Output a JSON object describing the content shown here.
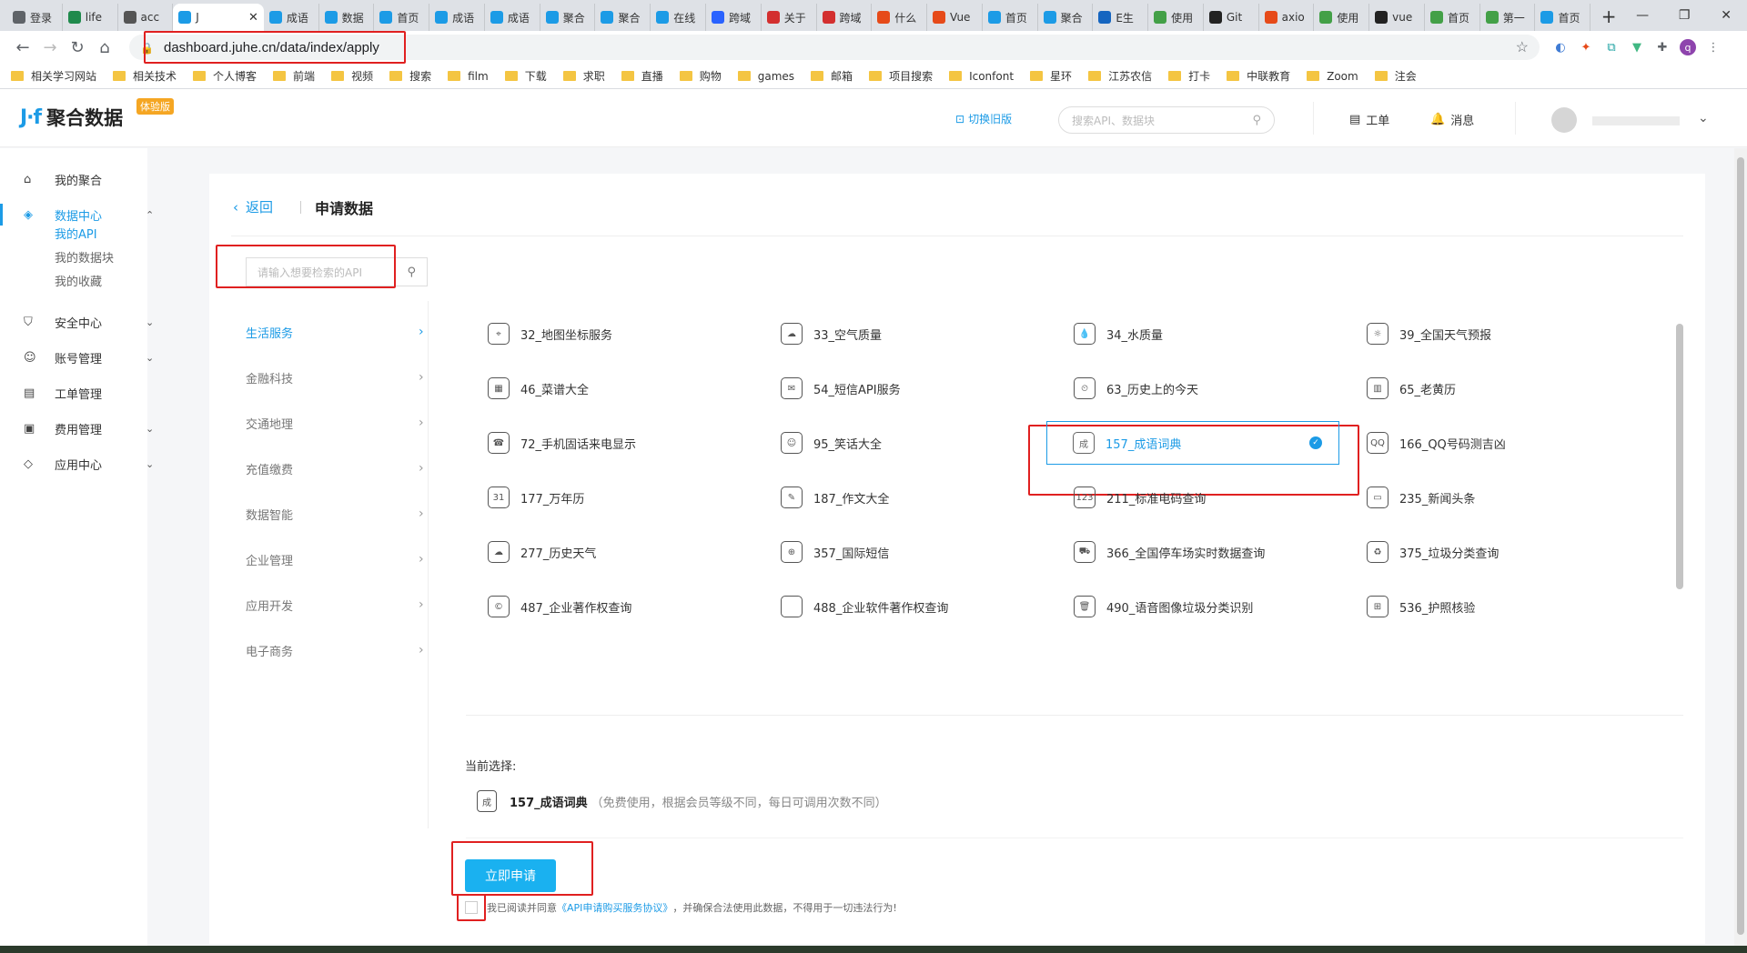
{
  "browser": {
    "tabs": [
      {
        "label": "登录",
        "color": "#5f6368"
      },
      {
        "label": "life",
        "color": "#1f8a4c"
      },
      {
        "label": "acc",
        "color": "#555555"
      },
      {
        "label": "J",
        "color": "#1c9be6",
        "active": true
      },
      {
        "label": "成语",
        "color": "#1c9be6"
      },
      {
        "label": "数据",
        "color": "#1c9be6"
      },
      {
        "label": "首页",
        "color": "#1c9be6"
      },
      {
        "label": "成语",
        "color": "#1c9be6"
      },
      {
        "label": "成语",
        "color": "#1c9be6"
      },
      {
        "label": "聚合",
        "color": "#1c9be6"
      },
      {
        "label": "聚合",
        "color": "#1c9be6"
      },
      {
        "label": "在线",
        "color": "#1c9be6"
      },
      {
        "label": "跨域",
        "color": "#2962ff"
      },
      {
        "label": "关于",
        "color": "#d32f2f"
      },
      {
        "label": "跨域",
        "color": "#d32f2f"
      },
      {
        "label": "什么",
        "color": "#e64a19"
      },
      {
        "label": "Vue",
        "color": "#e64a19"
      },
      {
        "label": "首页",
        "color": "#1c9be6"
      },
      {
        "label": "聚合",
        "color": "#1c9be6"
      },
      {
        "label": "E生",
        "color": "#1565c0"
      },
      {
        "label": "使用",
        "color": "#43a047"
      },
      {
        "label": "Git",
        "color": "#222222"
      },
      {
        "label": "axio",
        "color": "#e64a19"
      },
      {
        "label": "使用",
        "color": "#43a047"
      },
      {
        "label": "vue",
        "color": "#222222"
      },
      {
        "label": "首页",
        "color": "#43a047"
      },
      {
        "label": "第一",
        "color": "#43a047"
      },
      {
        "label": "首页",
        "color": "#1c9be6"
      }
    ],
    "url": "dashboard.juhe.cn/data/index/apply",
    "bookmarks": [
      "相关学习网站",
      "相关技术",
      "个人博客",
      "前端",
      "视频",
      "搜索",
      "film",
      "下载",
      "求职",
      "直播",
      "购物",
      "games",
      "邮箱",
      "项目搜索",
      "Iconfont",
      "星环",
      "江苏农信",
      "打卡",
      "中联教育",
      "Zoom",
      "注会"
    ]
  },
  "header": {
    "logo_text": "聚合数据",
    "logo_badge": "体验版",
    "old_version": "切换旧版",
    "search_placeholder": "搜索API、数据块",
    "ticket": "工单",
    "messages": "消息"
  },
  "sidebar": {
    "items": [
      {
        "label": "我的聚合",
        "icon": "home-icon"
      },
      {
        "label": "数据中心",
        "icon": "layers-icon",
        "active": true,
        "expanded": true
      },
      {
        "label": "安全中心",
        "icon": "shield-icon"
      },
      {
        "label": "账号管理",
        "icon": "user-icon"
      },
      {
        "label": "工单管理",
        "icon": "ticket-icon"
      },
      {
        "label": "费用管理",
        "icon": "wallet-icon"
      },
      {
        "label": "应用中心",
        "icon": "apps-icon"
      }
    ],
    "sub_items": [
      {
        "label": "我的API",
        "active": true
      },
      {
        "label": "我的数据块"
      },
      {
        "label": "我的收藏"
      }
    ]
  },
  "main": {
    "back": "返回",
    "title": "申请数据",
    "api_search_placeholder": "请输入想要检索的API",
    "categories": [
      "生活服务",
      "金融科技",
      "交通地理",
      "充值缴费",
      "数据智能",
      "企业管理",
      "应用开发",
      "电子商务"
    ],
    "apis": [
      "32_地图坐标服务",
      "33_空气质量",
      "34_水质量",
      "39_全国天气预报",
      "46_菜谱大全",
      "54_短信API服务",
      "63_历史上的今天",
      "65_老黄历",
      "72_手机固话来电显示",
      "95_笑话大全",
      "157_成语词典",
      "166_QQ号码测吉凶",
      "177_万年历",
      "187_作文大全",
      "211_标准电码查询",
      "235_新闻头条",
      "277_历史天气",
      "357_国际短信",
      "366_全国停车场实时数据查询",
      "375_垃圾分类查询",
      "487_企业著作权查询",
      "488_企业软件著作权查询",
      "490_语音图像垃圾分类识别",
      "536_护照核验"
    ],
    "selected_index": 10,
    "current_label": "当前选择:",
    "current_name": "157_成语词典",
    "current_note": "（免费使用，根据会员等级不同，每日可调用次数不同）",
    "apply_button": "立即申请",
    "agree_prefix": "我已阅读并同意",
    "agree_link": "《API申请购买服务协议》",
    "agree_suffix": "，并确保合法使用此数据，不得用于一切违法行为!"
  },
  "colors": {
    "accent": "#1c9be6",
    "button": "#1ab1f0",
    "annotation": "#e02020",
    "badge": "#f5a623"
  }
}
